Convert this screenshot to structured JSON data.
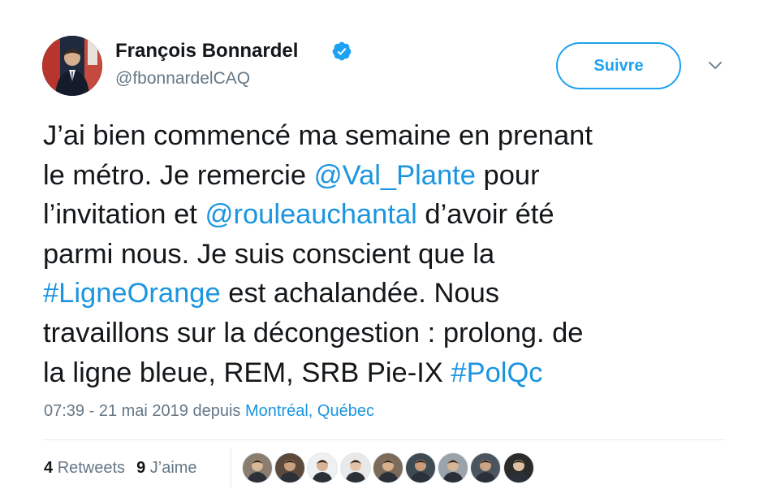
{
  "author": {
    "name": "François Bonnardel",
    "handle": "@fbonnardelCAQ",
    "avatar_icon": "profile-photo-icon",
    "verified_icon": "verified-badge-icon"
  },
  "follow_button": {
    "label": "Suivre"
  },
  "caret_icon": "chevron-down-icon",
  "tweet": {
    "lines": [
      [
        {
          "text": "J’ai bien commencé ma semaine en prenant"
        }
      ],
      [
        {
          "text": "le métro. Je remercie "
        },
        {
          "text": "@Val_Plante",
          "link": true
        },
        {
          "text": " pour"
        }
      ],
      [
        {
          "text": "l’invitation et "
        },
        {
          "text": "@rouleauchantal",
          "link": true
        },
        {
          "text": " d’avoir été"
        }
      ],
      [
        {
          "text": "parmi nous. Je suis conscient que la"
        }
      ],
      [
        {
          "text": "#LigneOrange",
          "link": true
        },
        {
          "text": " est achalandée. Nous"
        }
      ],
      [
        {
          "text": "travaillons sur la décongestion : prolong. de"
        }
      ],
      [
        {
          "text": "la ligne bleue, REM, SRB Pie-IX "
        },
        {
          "text": "#PolQc",
          "link": true
        }
      ]
    ]
  },
  "meta": {
    "time": "07:39 - 21 mai 2019",
    "via": " depuis ",
    "location": "Montréal, Québec"
  },
  "stats": {
    "retweets_count": "4",
    "retweets_label": "Retweets",
    "likes_count": "9",
    "likes_label": "J’aime"
  },
  "likers": [
    {
      "name": "liker-avatar-1",
      "bg": "#8a7d70",
      "face": "#d9b89a"
    },
    {
      "name": "liker-avatar-2",
      "bg": "#5b4a3c",
      "face": "#c9a080"
    },
    {
      "name": "liker-avatar-3",
      "bg": "#eef0f2",
      "face": "#d8b394"
    },
    {
      "name": "liker-avatar-4",
      "bg": "#e9e9ea",
      "face": "#e6c2a6"
    },
    {
      "name": "liker-avatar-5",
      "bg": "#7c6a5a",
      "face": "#d7b08e"
    },
    {
      "name": "liker-avatar-6",
      "bg": "#3e4a52",
      "face": "#c99b7a"
    },
    {
      "name": "liker-avatar-7",
      "bg": "#9aa3aa",
      "face": "#d6b595"
    },
    {
      "name": "liker-avatar-8",
      "bg": "#4a5560",
      "face": "#caa383"
    },
    {
      "name": "liker-avatar-9",
      "bg": "#2b2b2b",
      "face": "#e0c0a0"
    }
  ],
  "colors": {
    "accent": "#1da1f2",
    "link": "#1b95e0",
    "text": "#14171a",
    "secondary": "#657786",
    "divider": "#e6ecf0"
  }
}
